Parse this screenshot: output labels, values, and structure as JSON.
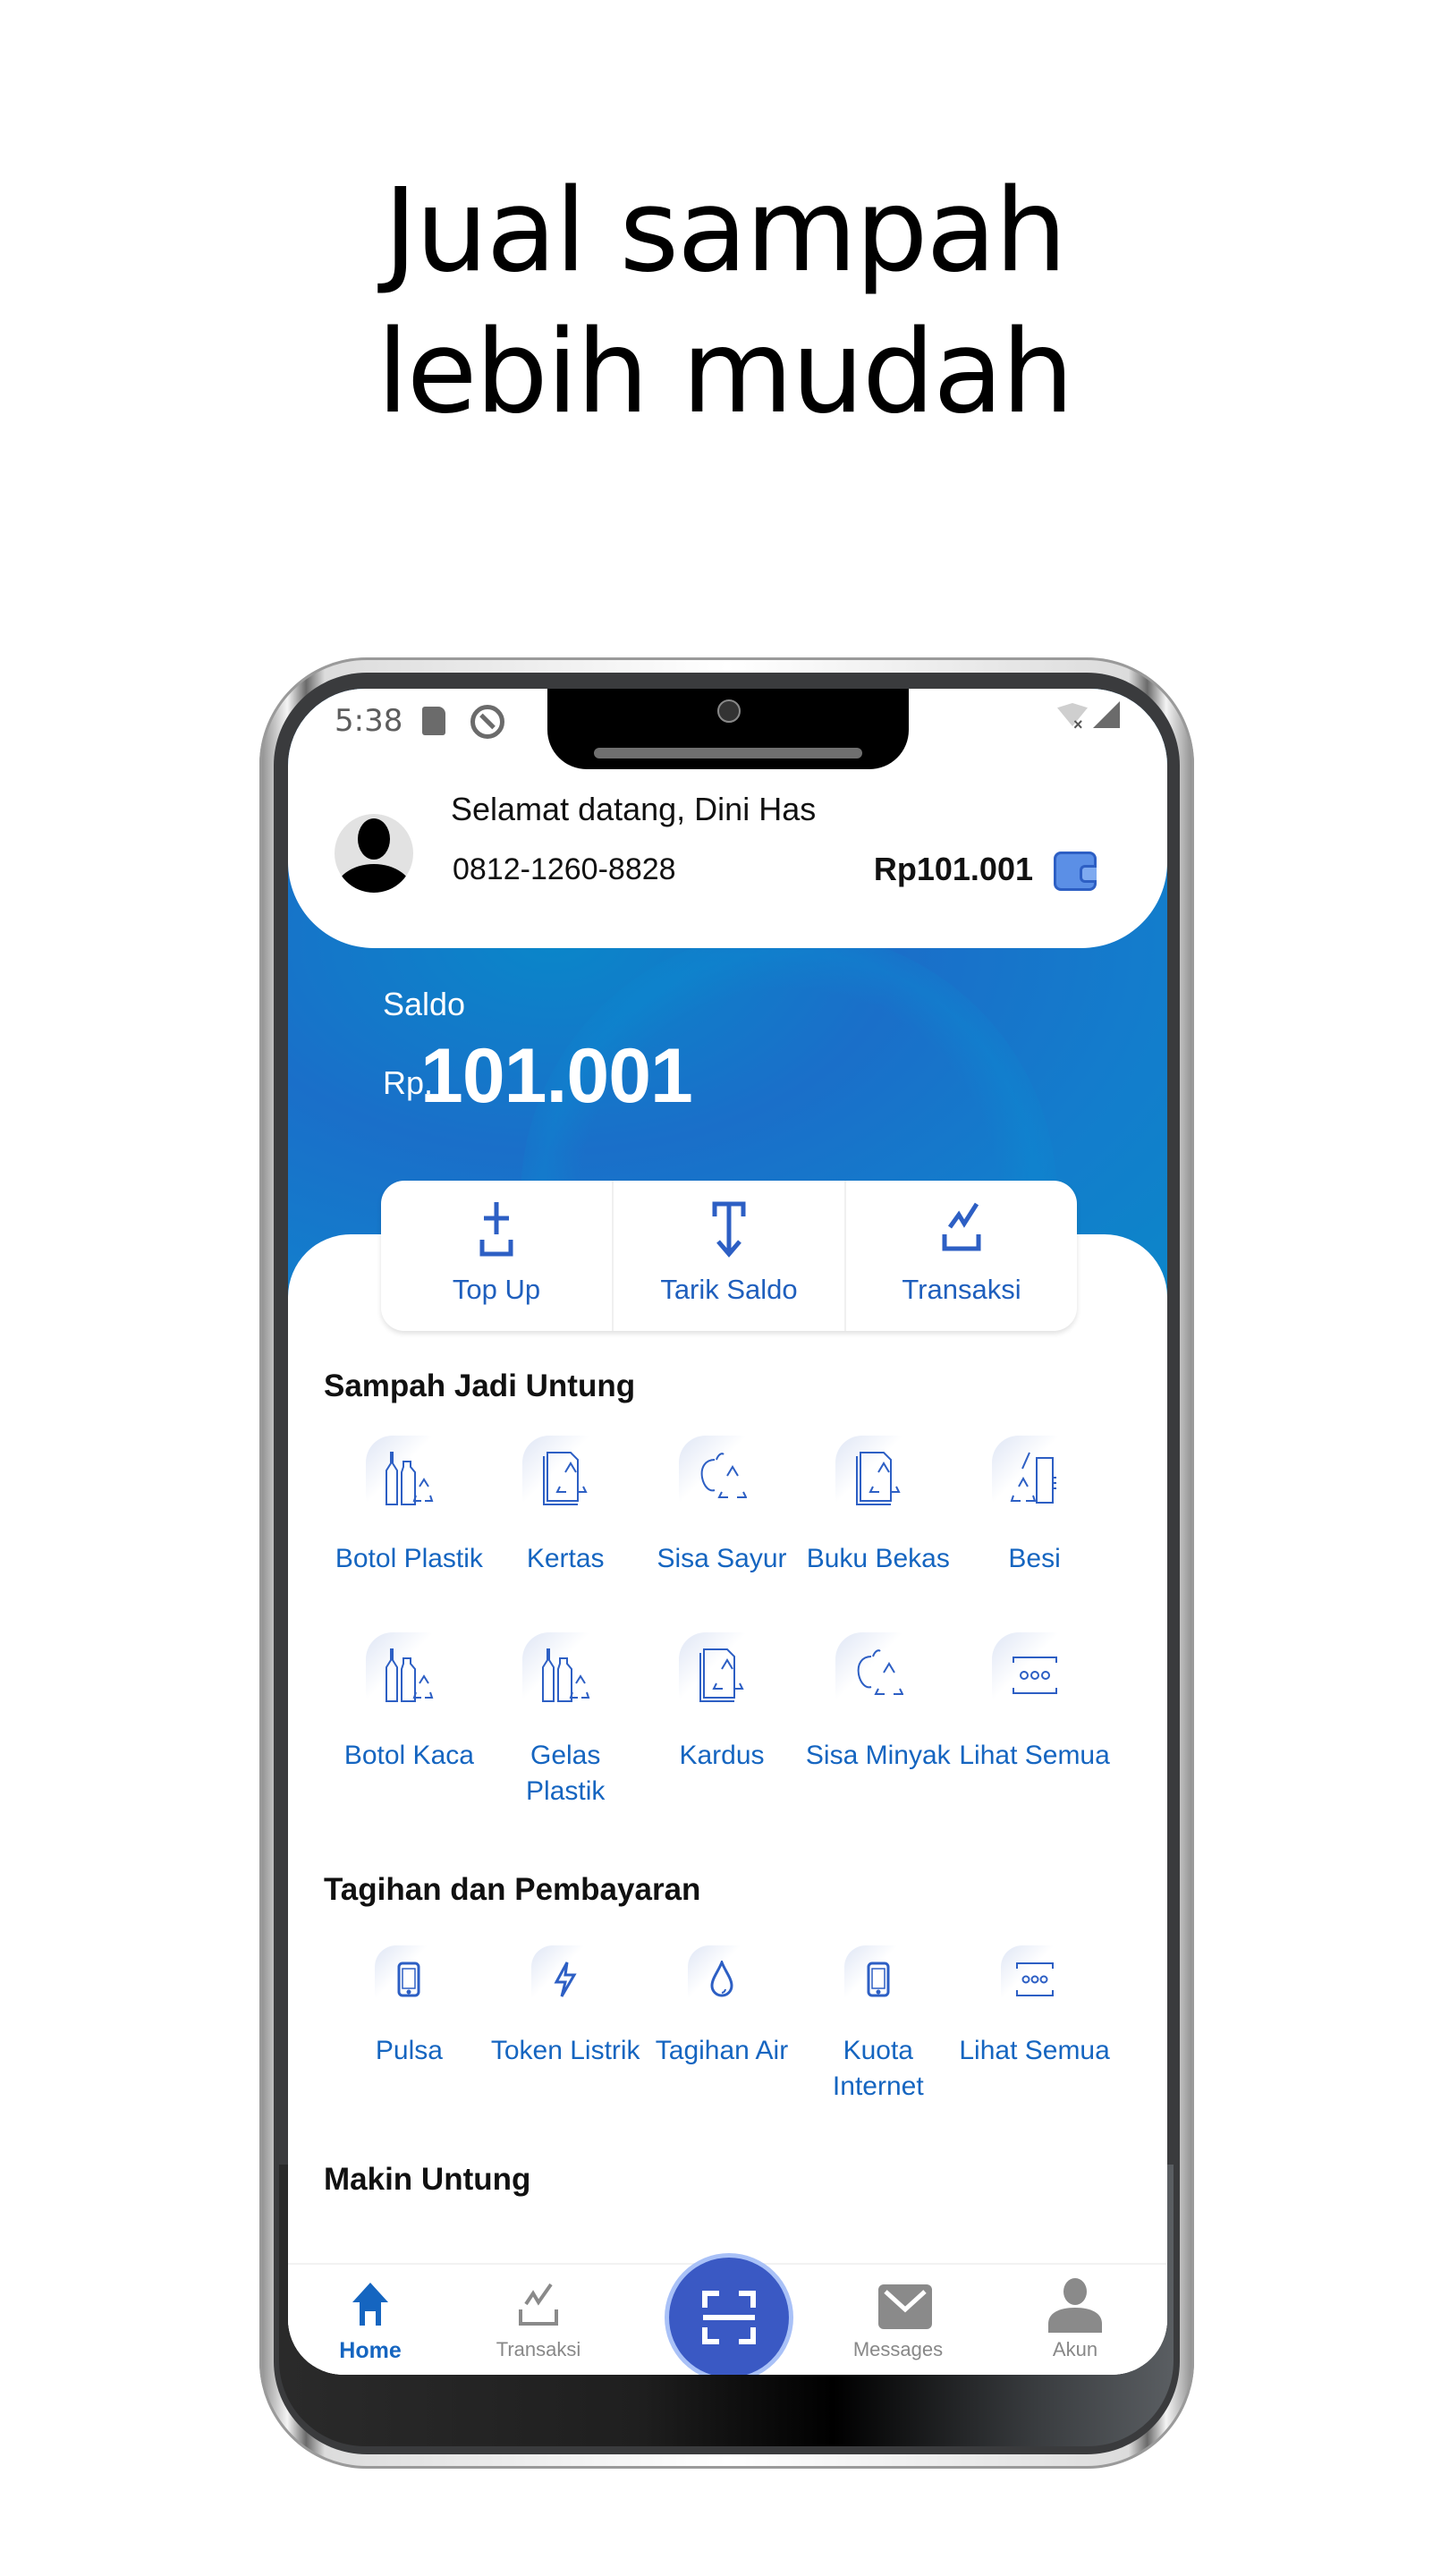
{
  "promo": {
    "headline_line1": "Jual sampah",
    "headline_line2": "lebih mudah"
  },
  "status_bar": {
    "time": "5:38",
    "icons": [
      "sd-card-icon",
      "sync-icon",
      "wifi-off-icon",
      "signal-icon"
    ]
  },
  "profile": {
    "greeting": "Selamat datang, Dini Has",
    "phone": "0812-1260-8828",
    "balance": "Rp101.001",
    "wallet_icon": "wallet-icon"
  },
  "balance": {
    "label": "Saldo",
    "prefix": "Rp.",
    "value": "101.001"
  },
  "actions": [
    {
      "label": "Top Up",
      "icon": "top-up-icon"
    },
    {
      "label": "Tarik Saldo",
      "icon": "withdraw-icon"
    },
    {
      "label": "Transaksi",
      "icon": "chart-icon"
    }
  ],
  "sampah_section": {
    "title": "Sampah Jadi Untung",
    "items": [
      {
        "label": "Botol Plastik",
        "icon": "bottle-recycle-icon"
      },
      {
        "label": "Kertas",
        "icon": "paper-recycle-icon"
      },
      {
        "label": "Sisa Sayur",
        "icon": "vegetable-recycle-icon"
      },
      {
        "label": "Buku Bekas",
        "icon": "book-recycle-icon"
      },
      {
        "label": "Besi",
        "icon": "metal-recycle-icon"
      },
      {
        "label": "Botol Kaca",
        "icon": "bottle-recycle-icon"
      },
      {
        "label": "Gelas Plastik",
        "icon": "bottle-recycle-icon"
      },
      {
        "label": "Kardus",
        "icon": "paper-recycle-icon"
      },
      {
        "label": "Sisa Minyak",
        "icon": "vegetable-recycle-icon"
      },
      {
        "label": "Lihat Semua",
        "icon": "more-icon"
      }
    ]
  },
  "tagihan_section": {
    "title": "Tagihan dan Pembayaran",
    "items": [
      {
        "label": "Pulsa",
        "icon": "phone-icon"
      },
      {
        "label": "Token Listrik",
        "icon": "lightning-icon"
      },
      {
        "label": "Tagihan Air",
        "icon": "water-drop-icon"
      },
      {
        "label": "Kuota Internet",
        "icon": "phone-icon"
      },
      {
        "label": "Lihat Semua",
        "icon": "more-icon"
      }
    ]
  },
  "makin_section": {
    "title": "Makin Untung"
  },
  "bottom_nav": {
    "items": [
      {
        "label": "Home",
        "icon": "home-icon",
        "active": true
      },
      {
        "label": "Transaksi",
        "icon": "chart-icon",
        "active": false
      },
      {
        "label": "",
        "icon": "scan-icon",
        "active": false
      },
      {
        "label": "Messages",
        "icon": "mail-icon",
        "active": false
      },
      {
        "label": "Akun",
        "icon": "user-icon",
        "active": false
      }
    ]
  },
  "colors": {
    "primary_blue": "#1565c0",
    "header_blue": "#1a6fc9",
    "scan_button": "#3a59c4",
    "inactive_gray": "#888888"
  }
}
